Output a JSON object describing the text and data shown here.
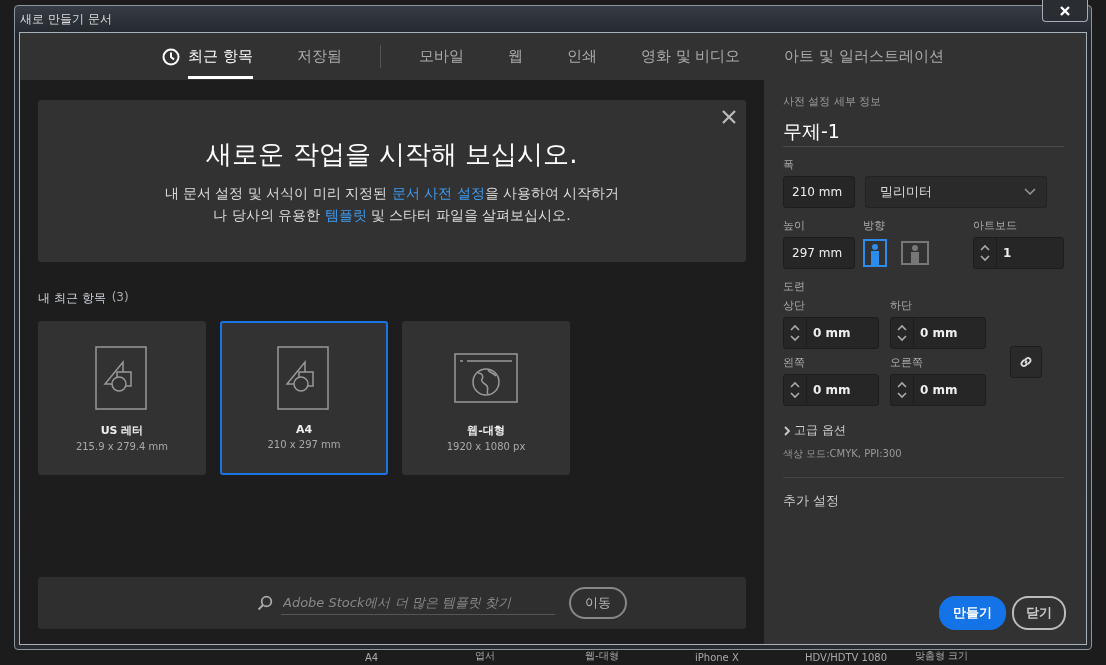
{
  "window": {
    "title": "새로 만들기 문서"
  },
  "tab_groups": [
    [
      {
        "label": "최근 항목",
        "selected": true,
        "kind": "recent"
      },
      {
        "label": "저장됨",
        "selected": false,
        "kind": "plain"
      }
    ],
    [
      {
        "label": "모바일",
        "selected": false,
        "kind": "plain"
      },
      {
        "label": "웹",
        "selected": false,
        "kind": "plain"
      },
      {
        "label": "인쇄",
        "selected": false,
        "kind": "plain"
      },
      {
        "label": "영화 및 비디오",
        "selected": false,
        "kind": "plain"
      },
      {
        "label": "아트 및 일러스트레이션",
        "selected": false,
        "kind": "plain"
      }
    ]
  ],
  "hero": {
    "title": "새로운 작업을 시작해 보십시오.",
    "lines": [
      [
        {
          "kind": "text",
          "text": "내 문서 설정 및 서식이 미리 지정된 "
        },
        {
          "kind": "link",
          "text": "문서 사전 설정"
        },
        {
          "kind": "text",
          "text": "을 사용하여 시작하거"
        }
      ],
      [
        {
          "kind": "text",
          "text": "나 당사의 유용한 "
        },
        {
          "kind": "link",
          "text": "템플릿"
        },
        {
          "kind": "text",
          "text": " 및 스타터 파일을 살펴보십시오."
        }
      ]
    ]
  },
  "recent": {
    "label": "내 최근 항목",
    "count": "(3)",
    "items": [
      {
        "name": "US 레터",
        "size": "215.9 x 279.4 mm",
        "selected": false,
        "kind": "document"
      },
      {
        "name": "A4",
        "size": "210 x 297 mm",
        "selected": true,
        "kind": "document"
      },
      {
        "name": "웹-대형",
        "size": "1920 x 1080 px",
        "selected": false,
        "kind": "web"
      }
    ]
  },
  "stock_search": {
    "placeholder": "Adobe Stock에서 더 많은 템플릿 찾기",
    "button": "이동"
  },
  "preset": {
    "section_label": "사전 설정 세부 정보",
    "name": "무제-1",
    "width_label": "폭",
    "width": "210 mm",
    "units": "밀리미터",
    "height_label": "높이",
    "height": "297 mm",
    "orientation_label": "방향",
    "orientations": [
      {
        "kind": "portrait",
        "selected": true
      },
      {
        "kind": "landscape",
        "selected": false
      }
    ],
    "artboards_label": "아트보드",
    "artboards": "1",
    "bleed_label": "도련",
    "bleed": [
      {
        "label": "상단",
        "value": "0 mm"
      },
      {
        "label": "하단",
        "value": "0 mm"
      },
      {
        "label": "왼쪽",
        "value": "0 mm"
      },
      {
        "label": "오른쪽",
        "value": "0 mm"
      }
    ],
    "advanced": "고급 옵션",
    "color_info": "색상 모드:CMYK, PPI:300",
    "more_settings": "추가 설정"
  },
  "buttons": [
    {
      "label": "만들기",
      "kind": "primary"
    },
    {
      "label": "닫기",
      "kind": "secondary"
    }
  ],
  "background_presets": [
    "A4",
    "엽서",
    "웹-대형",
    "iPhone X",
    "HDV/HDTV 1080",
    "맞춤형 크기"
  ]
}
